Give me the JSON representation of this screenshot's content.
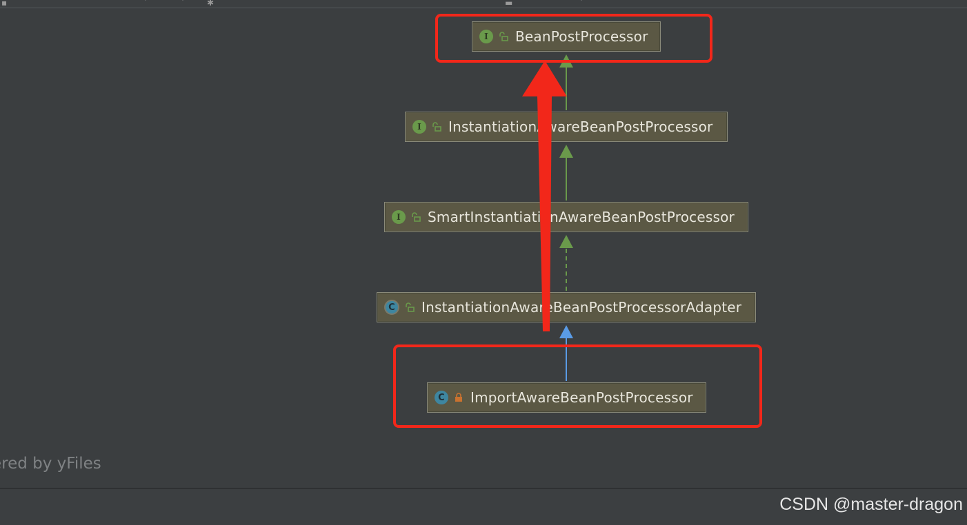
{
  "diagram": {
    "nodes": [
      {
        "label": "BeanPostProcessor",
        "kind": "interface",
        "visibility": "public"
      },
      {
        "label": "InstantiationAwareBeanPostProcessor",
        "kind": "interface",
        "visibility": "public"
      },
      {
        "label": "SmartInstantiationAwareBeanPostProcessor",
        "kind": "interface",
        "visibility": "public"
      },
      {
        "label": "InstantiationAwareBeanPostProcessorAdapter",
        "kind": "abstract-class",
        "visibility": "public"
      },
      {
        "label": "ImportAwareBeanPostProcessor",
        "kind": "class",
        "visibility": "private"
      }
    ],
    "badges": {
      "interface": "I",
      "class": "C"
    },
    "colors": {
      "interface_extends": "#6a9a4b",
      "class_extends": "#5a9be6",
      "annotation_arrow": "#f2271a",
      "highlight": "#f2271a"
    }
  },
  "footer": {
    "powered_by": "ered by yFiles",
    "watermark": "CSDN @master-dragon"
  }
}
